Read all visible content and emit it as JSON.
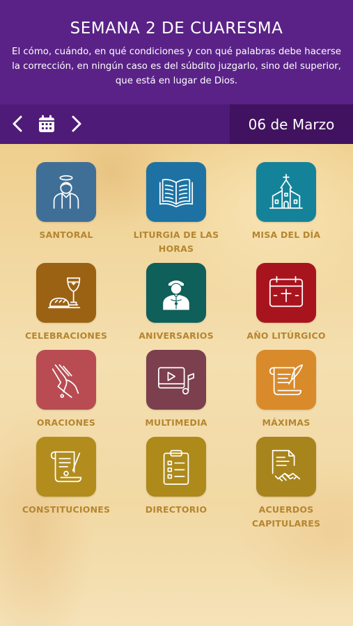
{
  "header": {
    "title": "SEMANA 2 DE CUARESMA",
    "subtitle": "El cómo, cuándo, en qué condiciones y con qué palabras debe hacerse la corrección, en ningún caso es del súbdito juzgarlo, sino del superior, que está en lugar de Dios."
  },
  "datebar": {
    "date": "06 de Marzo",
    "prev_icon": "chevron-left-icon",
    "calendar_icon": "calendar-icon",
    "next_icon": "chevron-right-icon"
  },
  "colors": {
    "header_bg": "#5a2287",
    "datebar_bg": "#4f1b78",
    "date_box_bg": "#41125f",
    "label_color": "#b5862f"
  },
  "menu": [
    {
      "label": "SANTORAL",
      "icon": "saint-icon",
      "color": "#3f6f96"
    },
    {
      "label": "LITURGIA DE LAS HORAS",
      "icon": "open-book-icon",
      "color": "#1d72a3"
    },
    {
      "label": "MISA DEL DÍA",
      "icon": "church-icon",
      "color": "#14839a"
    },
    {
      "label": "CELEBRACIONES",
      "icon": "bread-chalice-icon",
      "color": "#9b6214"
    },
    {
      "label": "ANIVERSARIOS",
      "icon": "priest-icon",
      "color": "#0f5f5a"
    },
    {
      "label": "AÑO LITÚRGICO",
      "icon": "liturgical-calendar-icon",
      "color": "#a8141e"
    },
    {
      "label": "ORACIONES",
      "icon": "praying-hands-icon",
      "color": "#b84c52"
    },
    {
      "label": "MULTIMEDIA",
      "icon": "multimedia-icon",
      "color": "#7c3f4d"
    },
    {
      "label": "MÁXIMAS",
      "icon": "scroll-quill-icon",
      "color": "#d98a2b"
    },
    {
      "label": "CONSTITUCIONES",
      "icon": "scroll-document-icon",
      "color": "#b28d1e"
    },
    {
      "label": "DIRECTORIO",
      "icon": "clipboard-list-icon",
      "color": "#ad8a1a"
    },
    {
      "label": "ACUERDOS CAPITULARES",
      "icon": "agreement-handshake-icon",
      "color": "#a8841c"
    }
  ]
}
